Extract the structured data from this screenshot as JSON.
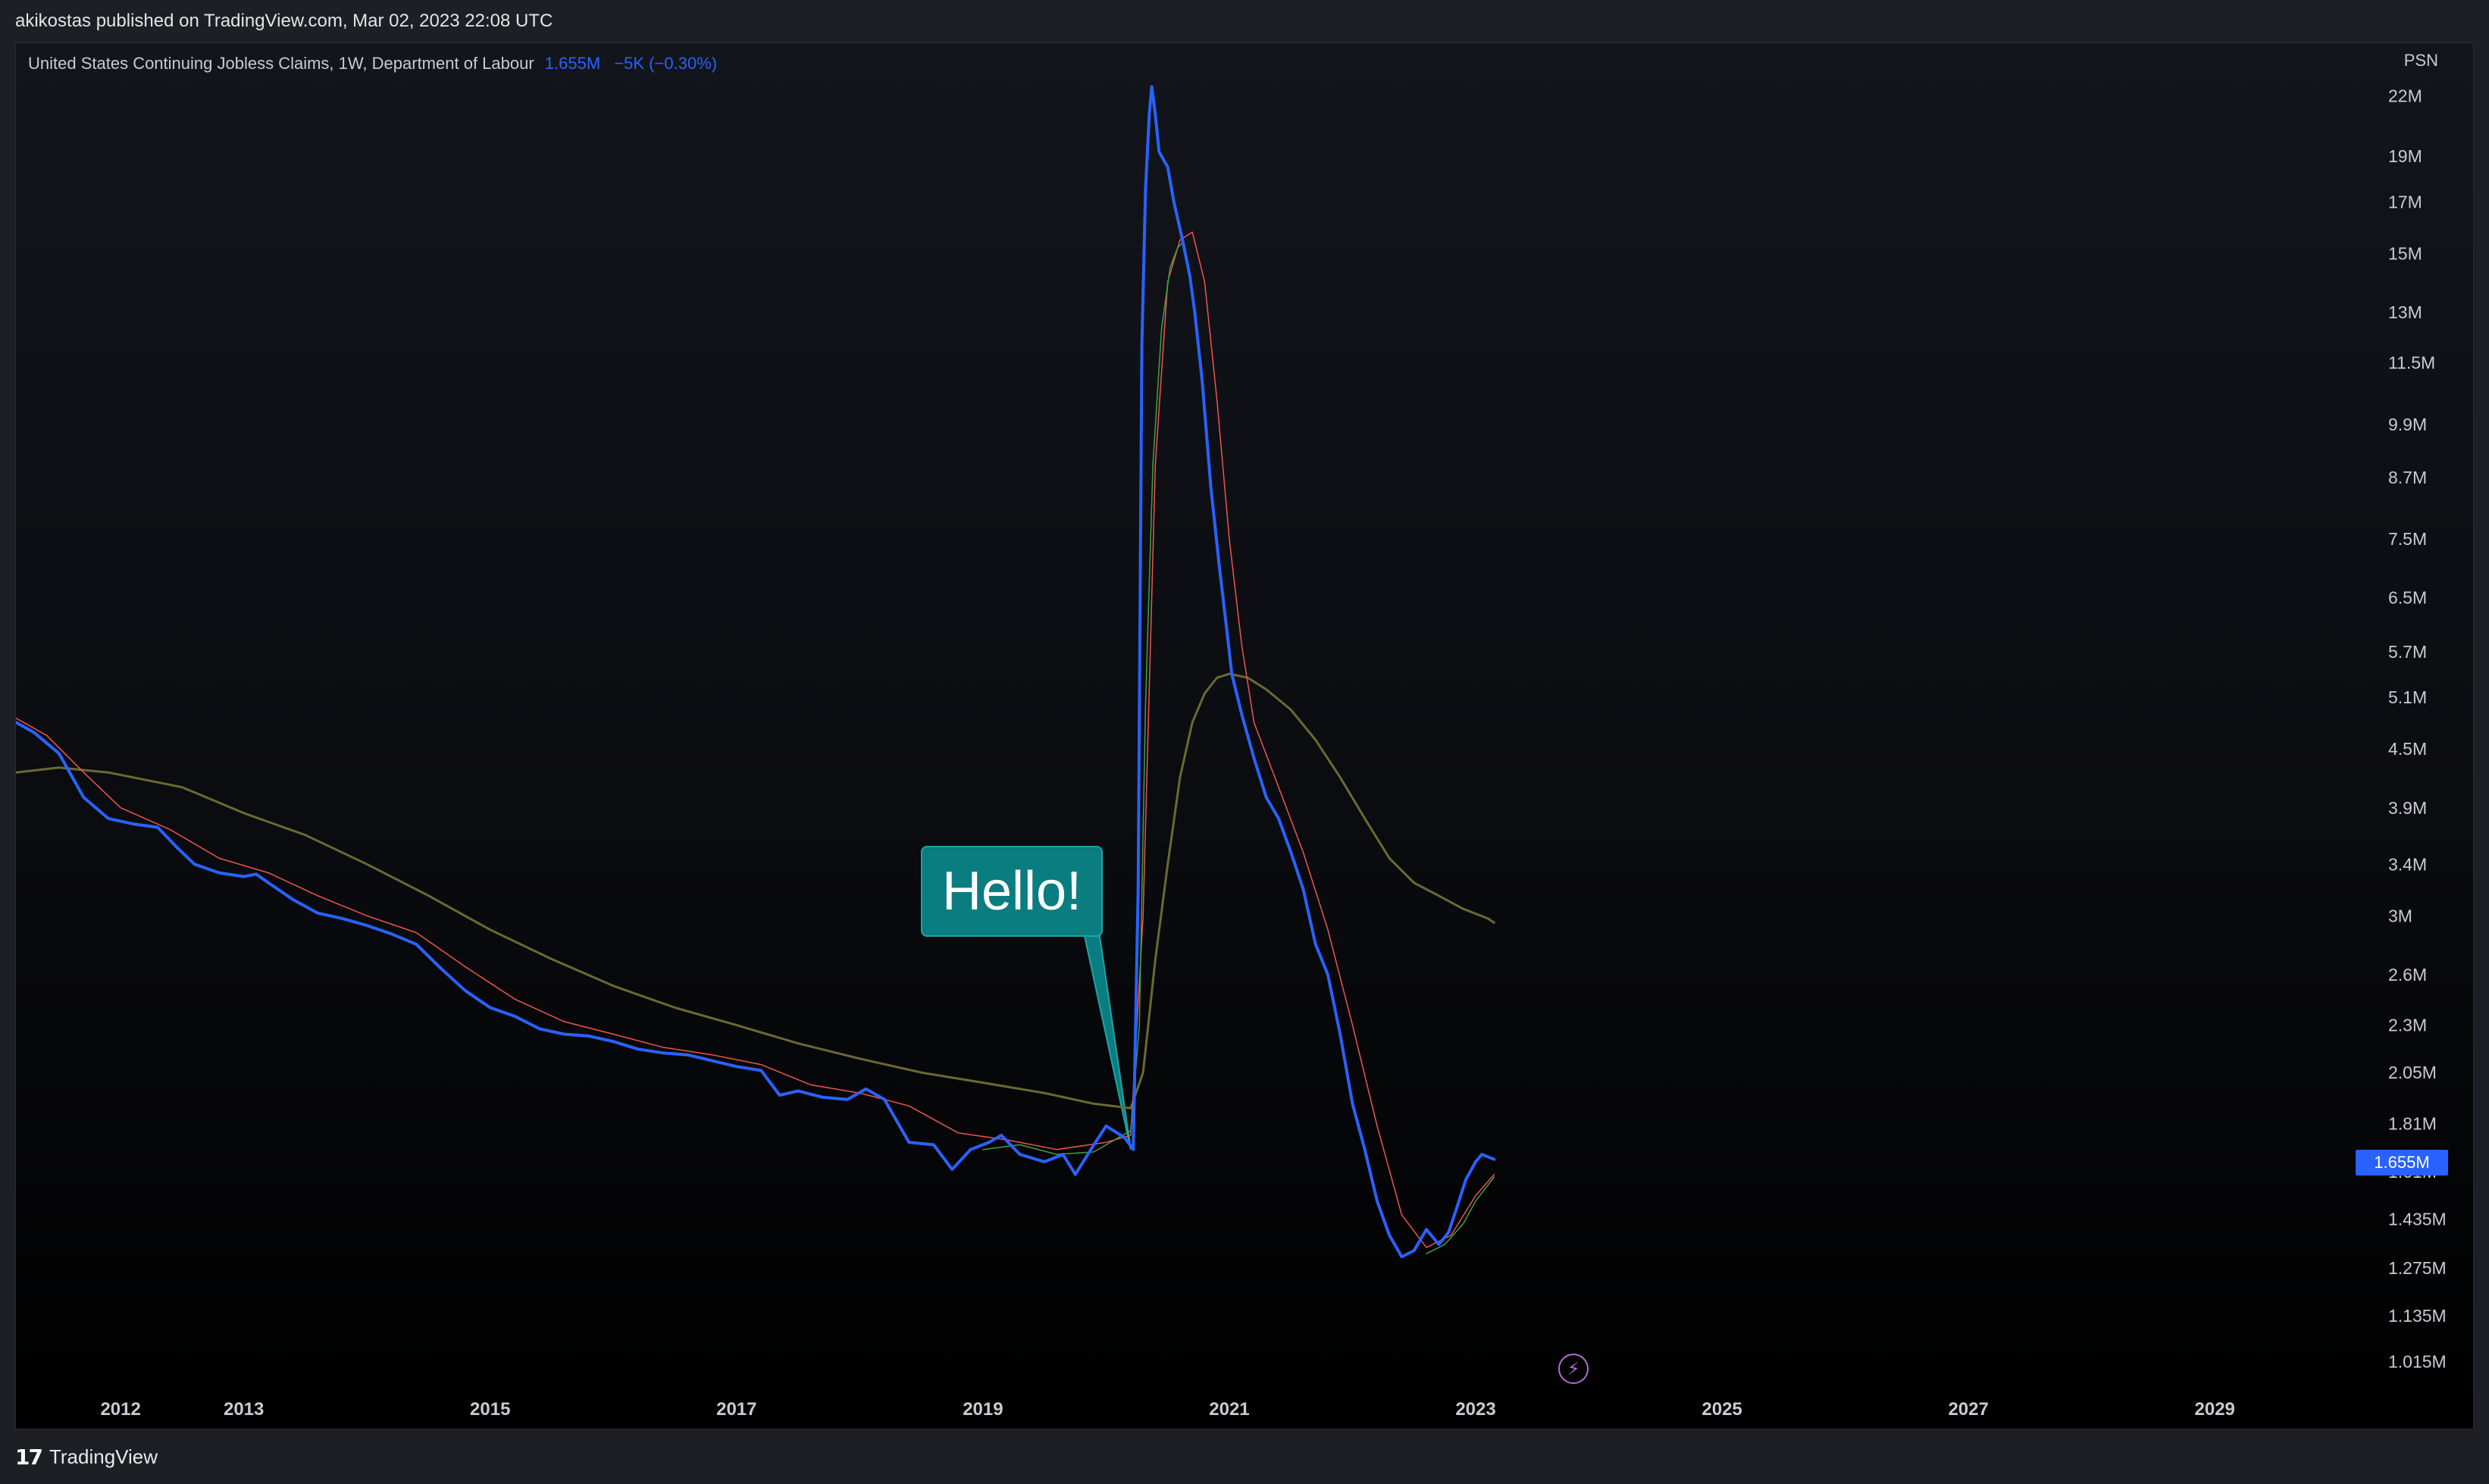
{
  "header": {
    "published_text": "akikostas published on TradingView.com, Mar 02, 2023 22:08 UTC"
  },
  "legend": {
    "title": "United States Continuing Jobless Claims, 1W, Department of Labour",
    "value": "1.655M",
    "change": "−5K (−0.30%)"
  },
  "footer": {
    "brand": "TradingView",
    "logo_glyph": "17"
  },
  "annotation": {
    "text": "Hello!"
  },
  "icons": {
    "speed": "lightning-icon"
  },
  "chart_data": {
    "type": "line",
    "title": "United States Continuing Jobless Claims, 1W, Department of Labour",
    "y_scale": "log",
    "ylim": [
      960000,
      25000000
    ],
    "xlim": [
      2011.15,
      2030.1
    ],
    "y_axis_label": "PSN",
    "y_ticks": [
      {
        "value": 22000000,
        "label": "22M"
      },
      {
        "value": 19000000,
        "label": "19M"
      },
      {
        "value": 17000000,
        "label": "17M"
      },
      {
        "value": 15000000,
        "label": "15M"
      },
      {
        "value": 13000000,
        "label": "13M"
      },
      {
        "value": 11500000,
        "label": "11.5M"
      },
      {
        "value": 9900000,
        "label": "9.9M"
      },
      {
        "value": 8700000,
        "label": "8.7M"
      },
      {
        "value": 7500000,
        "label": "7.5M"
      },
      {
        "value": 6500000,
        "label": "6.5M"
      },
      {
        "value": 5700000,
        "label": "5.7M"
      },
      {
        "value": 5100000,
        "label": "5.1M"
      },
      {
        "value": 4500000,
        "label": "4.5M"
      },
      {
        "value": 3900000,
        "label": "3.9M"
      },
      {
        "value": 3400000,
        "label": "3.4M"
      },
      {
        "value": 3000000,
        "label": "3M"
      },
      {
        "value": 2600000,
        "label": "2.6M"
      },
      {
        "value": 2300000,
        "label": "2.3M"
      },
      {
        "value": 2050000,
        "label": "2.05M"
      },
      {
        "value": 1810000,
        "label": "1.81M"
      },
      {
        "value": 1610000,
        "label": "1.61M"
      },
      {
        "value": 1435000,
        "label": "1.435M"
      },
      {
        "value": 1275000,
        "label": "1.275M"
      },
      {
        "value": 1135000,
        "label": "1.135M"
      },
      {
        "value": 1015000,
        "label": "1.015M"
      }
    ],
    "x_ticks": [
      {
        "value": 2012,
        "label": "2012"
      },
      {
        "value": 2013,
        "label": "2013"
      },
      {
        "value": 2015,
        "label": "2015"
      },
      {
        "value": 2017,
        "label": "2017"
      },
      {
        "value": 2019,
        "label": "2019"
      },
      {
        "value": 2021,
        "label": "2021"
      },
      {
        "value": 2023,
        "label": "2023"
      },
      {
        "value": 2025,
        "label": "2025"
      },
      {
        "value": 2027,
        "label": "2027"
      },
      {
        "value": 2029,
        "label": "2029"
      }
    ],
    "last_value": {
      "value": 1655000,
      "label": "1.655M",
      "color": "#2962ff"
    },
    "annotation_point": {
      "x": 2020.2,
      "y": 1700000
    },
    "series": [
      {
        "color": "#2962ff",
        "width": 4,
        "points": [
          [
            2011.15,
            4800000
          ],
          [
            2011.3,
            4680000
          ],
          [
            2011.5,
            4450000
          ],
          [
            2011.7,
            4000000
          ],
          [
            2011.9,
            3800000
          ],
          [
            2012.1,
            3750000
          ],
          [
            2012.3,
            3720000
          ],
          [
            2012.45,
            3550000
          ],
          [
            2012.6,
            3400000
          ],
          [
            2012.8,
            3330000
          ],
          [
            2013.0,
            3300000
          ],
          [
            2013.1,
            3320000
          ],
          [
            2013.2,
            3250000
          ],
          [
            2013.4,
            3120000
          ],
          [
            2013.6,
            3020000
          ],
          [
            2013.8,
            2980000
          ],
          [
            2014.0,
            2930000
          ],
          [
            2014.2,
            2870000
          ],
          [
            2014.4,
            2800000
          ],
          [
            2014.6,
            2640000
          ],
          [
            2014.8,
            2500000
          ],
          [
            2015.0,
            2400000
          ],
          [
            2015.2,
            2350000
          ],
          [
            2015.4,
            2280000
          ],
          [
            2015.6,
            2250000
          ],
          [
            2015.8,
            2240000
          ],
          [
            2016.0,
            2210000
          ],
          [
            2016.2,
            2170000
          ],
          [
            2016.4,
            2150000
          ],
          [
            2016.6,
            2140000
          ],
          [
            2016.8,
            2110000
          ],
          [
            2017.0,
            2080000
          ],
          [
            2017.2,
            2060000
          ],
          [
            2017.35,
            1940000
          ],
          [
            2017.5,
            1960000
          ],
          [
            2017.7,
            1930000
          ],
          [
            2017.9,
            1920000
          ],
          [
            2018.05,
            1970000
          ],
          [
            2018.2,
            1920000
          ],
          [
            2018.4,
            1730000
          ],
          [
            2018.6,
            1720000
          ],
          [
            2018.75,
            1620000
          ],
          [
            2018.9,
            1700000
          ],
          [
            2019.05,
            1730000
          ],
          [
            2019.15,
            1760000
          ],
          [
            2019.3,
            1680000
          ],
          [
            2019.5,
            1650000
          ],
          [
            2019.65,
            1680000
          ],
          [
            2019.75,
            1600000
          ],
          [
            2019.9,
            1720000
          ],
          [
            2020.0,
            1800000
          ],
          [
            2020.15,
            1750000
          ],
          [
            2020.22,
            1700000
          ],
          [
            2020.26,
            3200000
          ],
          [
            2020.29,
            12000000
          ],
          [
            2020.32,
            17500000
          ],
          [
            2020.35,
            21000000
          ],
          [
            2020.37,
            22500000
          ],
          [
            2020.4,
            21000000
          ],
          [
            2020.43,
            19200000
          ],
          [
            2020.5,
            18500000
          ],
          [
            2020.55,
            17000000
          ],
          [
            2020.62,
            15500000
          ],
          [
            2020.68,
            14200000
          ],
          [
            2020.72,
            13000000
          ],
          [
            2020.78,
            11000000
          ],
          [
            2020.85,
            8500000
          ],
          [
            2020.92,
            7000000
          ],
          [
            2020.98,
            6000000
          ],
          [
            2021.02,
            5400000
          ],
          [
            2021.1,
            4900000
          ],
          [
            2021.2,
            4400000
          ],
          [
            2021.3,
            4000000
          ],
          [
            2021.4,
            3800000
          ],
          [
            2021.5,
            3500000
          ],
          [
            2021.6,
            3200000
          ],
          [
            2021.7,
            2800000
          ],
          [
            2021.8,
            2600000
          ],
          [
            2021.9,
            2250000
          ],
          [
            2022.0,
            1900000
          ],
          [
            2022.1,
            1700000
          ],
          [
            2022.2,
            1500000
          ],
          [
            2022.3,
            1380000
          ],
          [
            2022.4,
            1310000
          ],
          [
            2022.5,
            1330000
          ],
          [
            2022.6,
            1400000
          ],
          [
            2022.7,
            1350000
          ],
          [
            2022.78,
            1390000
          ],
          [
            2022.85,
            1480000
          ],
          [
            2022.92,
            1580000
          ],
          [
            2023.0,
            1650000
          ],
          [
            2023.05,
            1680000
          ],
          [
            2023.1,
            1670000
          ],
          [
            2023.15,
            1660000
          ]
        ]
      },
      {
        "color": "#ef5350",
        "width": 1.5,
        "points": [
          [
            2011.15,
            4850000
          ],
          [
            2011.4,
            4650000
          ],
          [
            2011.7,
            4250000
          ],
          [
            2012.0,
            3900000
          ],
          [
            2012.4,
            3700000
          ],
          [
            2012.8,
            3450000
          ],
          [
            2013.2,
            3330000
          ],
          [
            2013.6,
            3150000
          ],
          [
            2014.0,
            3000000
          ],
          [
            2014.4,
            2880000
          ],
          [
            2014.8,
            2650000
          ],
          [
            2015.2,
            2450000
          ],
          [
            2015.6,
            2320000
          ],
          [
            2016.0,
            2250000
          ],
          [
            2016.4,
            2180000
          ],
          [
            2016.8,
            2140000
          ],
          [
            2017.2,
            2090000
          ],
          [
            2017.6,
            1990000
          ],
          [
            2018.0,
            1950000
          ],
          [
            2018.4,
            1890000
          ],
          [
            2018.8,
            1770000
          ],
          [
            2019.2,
            1740000
          ],
          [
            2019.6,
            1700000
          ],
          [
            2020.0,
            1730000
          ],
          [
            2020.2,
            1760000
          ],
          [
            2020.3,
            3000000
          ],
          [
            2020.4,
            9000000
          ],
          [
            2020.5,
            14000000
          ],
          [
            2020.6,
            15500000
          ],
          [
            2020.7,
            15800000
          ],
          [
            2020.8,
            14000000
          ],
          [
            2020.9,
            10500000
          ],
          [
            2021.0,
            7500000
          ],
          [
            2021.1,
            5800000
          ],
          [
            2021.2,
            4800000
          ],
          [
            2021.4,
            4100000
          ],
          [
            2021.6,
            3500000
          ],
          [
            2021.8,
            2900000
          ],
          [
            2022.0,
            2300000
          ],
          [
            2022.2,
            1800000
          ],
          [
            2022.4,
            1450000
          ],
          [
            2022.6,
            1340000
          ],
          [
            2022.8,
            1380000
          ],
          [
            2023.0,
            1520000
          ],
          [
            2023.15,
            1600000
          ]
        ]
      },
      {
        "color": "#43a047",
        "width": 1.5,
        "points": [
          [
            2019.0,
            1700000
          ],
          [
            2019.3,
            1720000
          ],
          [
            2019.6,
            1680000
          ],
          [
            2019.9,
            1690000
          ],
          [
            2020.1,
            1750000
          ],
          [
            2020.2,
            1780000
          ],
          [
            2020.27,
            2300000
          ],
          [
            2020.32,
            5000000
          ],
          [
            2020.38,
            9000000
          ],
          [
            2020.45,
            12500000
          ],
          [
            2020.52,
            14500000
          ],
          [
            2020.58,
            15200000
          ],
          [
            2020.62,
            15400000
          ]
        ]
      },
      {
        "color": "#43a047",
        "width": 1.5,
        "points": [
          [
            2022.6,
            1320000
          ],
          [
            2022.75,
            1350000
          ],
          [
            2022.9,
            1420000
          ],
          [
            2023.0,
            1500000
          ],
          [
            2023.15,
            1590000
          ]
        ]
      },
      {
        "color": "#6b6a30",
        "width": 3,
        "points": [
          [
            2011.15,
            4250000
          ],
          [
            2011.5,
            4300000
          ],
          [
            2011.9,
            4250000
          ],
          [
            2012.5,
            4100000
          ],
          [
            2013.0,
            3850000
          ],
          [
            2013.5,
            3650000
          ],
          [
            2014.0,
            3400000
          ],
          [
            2014.5,
            3150000
          ],
          [
            2015.0,
            2900000
          ],
          [
            2015.5,
            2700000
          ],
          [
            2016.0,
            2530000
          ],
          [
            2016.5,
            2400000
          ],
          [
            2017.0,
            2300000
          ],
          [
            2017.5,
            2200000
          ],
          [
            2018.0,
            2120000
          ],
          [
            2018.5,
            2050000
          ],
          [
            2019.0,
            2000000
          ],
          [
            2019.5,
            1950000
          ],
          [
            2019.9,
            1900000
          ],
          [
            2020.2,
            1880000
          ],
          [
            2020.3,
            2050000
          ],
          [
            2020.4,
            2700000
          ],
          [
            2020.5,
            3400000
          ],
          [
            2020.6,
            4200000
          ],
          [
            2020.7,
            4800000
          ],
          [
            2020.8,
            5150000
          ],
          [
            2020.9,
            5350000
          ],
          [
            2021.0,
            5400000
          ],
          [
            2021.15,
            5350000
          ],
          [
            2021.3,
            5200000
          ],
          [
            2021.5,
            4950000
          ],
          [
            2021.7,
            4600000
          ],
          [
            2021.9,
            4200000
          ],
          [
            2022.1,
            3800000
          ],
          [
            2022.3,
            3450000
          ],
          [
            2022.5,
            3250000
          ],
          [
            2022.7,
            3150000
          ],
          [
            2022.9,
            3050000
          ],
          [
            2023.1,
            2980000
          ],
          [
            2023.15,
            2950000
          ]
        ]
      }
    ]
  }
}
